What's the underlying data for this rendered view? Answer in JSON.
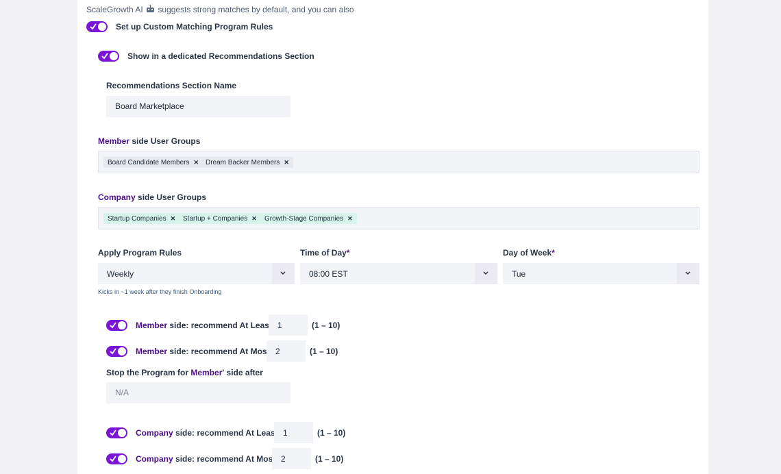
{
  "intro": {
    "prefix": "ScaleGrowth AI",
    "suffix": "suggests strong matches by default, and you can also"
  },
  "custom_rules": {
    "label": "Set up Custom Matching Program Rules",
    "enabled": true
  },
  "dedicated_section": {
    "label": "Show in a dedicated Recommendations Section",
    "enabled": true
  },
  "section_name": {
    "label": "Recommendations Section Name",
    "value": "Board Marketplace"
  },
  "member_groups": {
    "label_accent": "Member",
    "label_rest": " side User Groups",
    "tags": [
      "Board Candidate Members",
      "Dream Backer Members"
    ]
  },
  "company_groups": {
    "label_accent": "Company",
    "label_rest": " side User Groups",
    "tags": [
      "Startup Companies",
      "Startup + Companies",
      "Growth-Stage Companies"
    ]
  },
  "apply_rules": {
    "label": "Apply Program Rules",
    "value": "Weekly",
    "hint": "Kicks in ~1 week after they finish Onboarding"
  },
  "time_of_day": {
    "label": "Time of Day",
    "required": "*",
    "value": "08:00 EST"
  },
  "day_of_week": {
    "label": "Day of Week",
    "required": "*",
    "value": "Tue"
  },
  "member_at_least": {
    "accent": "Member",
    "rest": " side: recommend At Least",
    "value": "1",
    "range": "(1 – 10)",
    "enabled": true
  },
  "member_at_most": {
    "accent": "Member",
    "rest": " side: recommend At Most",
    "value": "2",
    "range": "(1 – 10)",
    "enabled": true
  },
  "stop_program": {
    "prefix": "Stop the Program for ",
    "accent": "Member",
    "suffix": "' side after",
    "placeholder": "N/A"
  },
  "company_at_least": {
    "accent": "Company",
    "rest": " side: recommend At Least",
    "value": "1",
    "range": "(1 – 10)",
    "enabled": true
  },
  "company_at_most": {
    "accent": "Company",
    "rest": " side: recommend At Most",
    "value": "2",
    "range": "(1 – 10)",
    "enabled": true
  },
  "colors": {
    "accent": "#7b16d6",
    "label_accent": "#4b0f8a",
    "field_bg": "#f3f4f8",
    "tag_green": "#d6f4ea"
  }
}
